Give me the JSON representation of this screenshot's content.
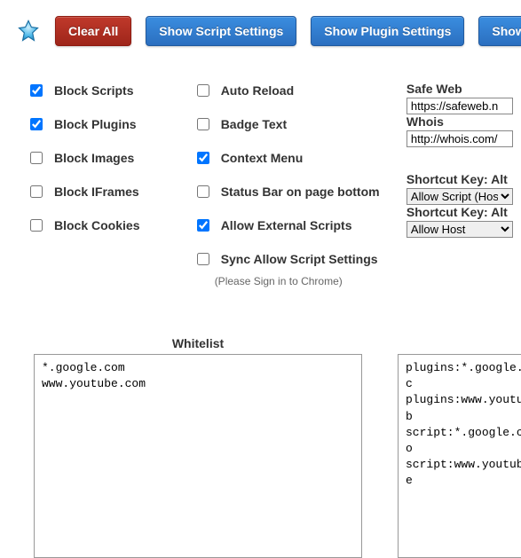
{
  "buttons": {
    "clear_all": "Clear All",
    "show_script": "Show Script Settings",
    "show_plugin": "Show Plugin Settings",
    "show_image": "Show Imag"
  },
  "col1": [
    {
      "label": "Block Scripts",
      "checked": true
    },
    {
      "label": "Block Plugins",
      "checked": true
    },
    {
      "label": "Block Images",
      "checked": false
    },
    {
      "label": "Block IFrames",
      "checked": false
    },
    {
      "label": "Block Cookies",
      "checked": false
    }
  ],
  "col2": [
    {
      "label": "Auto Reload",
      "checked": false
    },
    {
      "label": "Badge Text",
      "checked": false
    },
    {
      "label": "Context Menu",
      "checked": true
    },
    {
      "label": "Status Bar on page bottom",
      "checked": false
    },
    {
      "label": "Allow External Scripts",
      "checked": true
    },
    {
      "label": "Sync Allow Script Settings",
      "checked": false
    }
  ],
  "col2_hint": "(Please Sign in to Chrome)",
  "fields": {
    "safe_web": {
      "label": "Safe Web",
      "value": "https://safeweb.n"
    },
    "whois": {
      "label": "Whois",
      "value": "http://whois.com/"
    },
    "sk1": {
      "label": "Shortcut Key: Alt",
      "value": "Allow Script (Hos"
    },
    "sk2": {
      "label": "Shortcut Key: Alt",
      "value": "Allow Host"
    }
  },
  "whitelist": {
    "title": "Whitelist",
    "content": "*.google.com\nwww.youtube.com"
  },
  "rules": {
    "content": "plugins:*.google.c\nplugins:www.youtub\nscript:*.google.co\nscript:www.youtube"
  }
}
